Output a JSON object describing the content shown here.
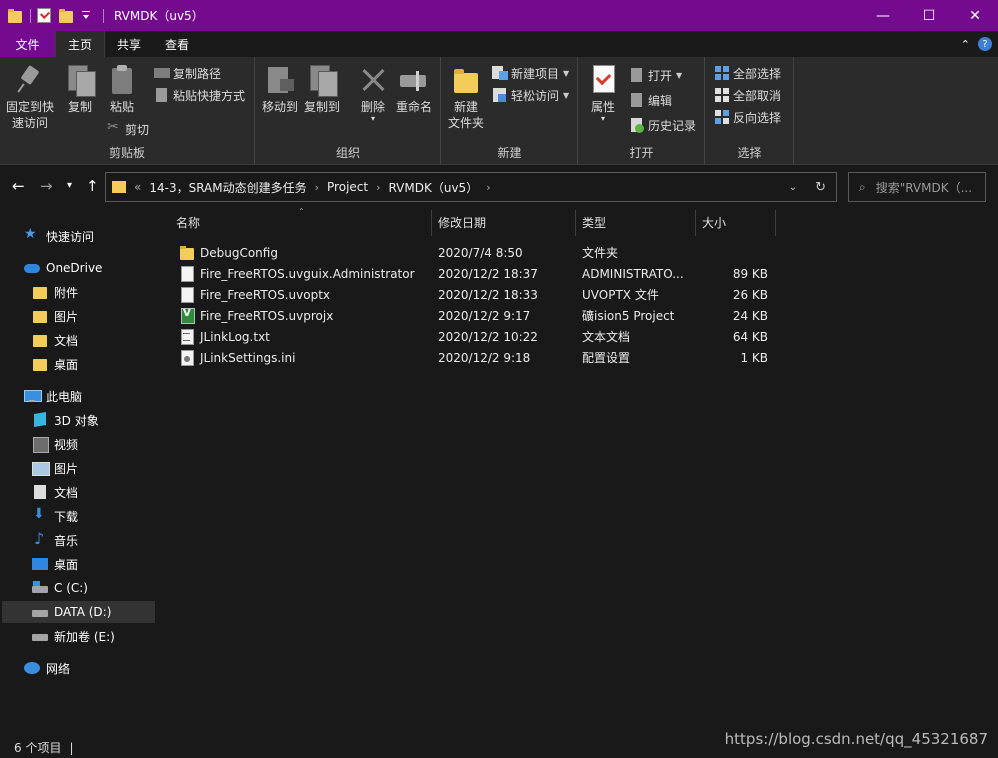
{
  "window": {
    "title": "RVMDK（uv5）",
    "controls": [
      "—",
      "☐",
      "✕"
    ],
    "accent": "#740b8f"
  },
  "ribbon_tabs": {
    "file": "文件",
    "home": "主页",
    "share": "共享",
    "view": "查看"
  },
  "ribbon": {
    "clipboard": {
      "label": "剪贴板",
      "pin": "固定到快\n速访问",
      "pin_l1": "固定到快",
      "pin_l2": "速访问",
      "copy": "复制",
      "paste": "粘贴",
      "copy_path": "复制路径",
      "paste_shortcut": "粘贴快捷方式",
      "cut": "剪切"
    },
    "organize": {
      "label": "组织",
      "move_to": "移动到",
      "copy_to": "复制到",
      "delete": "删除",
      "rename": "重命名"
    },
    "new": {
      "label": "新建",
      "new_folder_l1": "新建",
      "new_folder_l2": "文件夹",
      "new_item": "新建项目",
      "easy_access": "轻松访问"
    },
    "open": {
      "label": "打开",
      "properties": "属性",
      "open": "打开",
      "edit": "编辑",
      "history": "历史记录"
    },
    "select": {
      "label": "选择",
      "select_all": "全部选择",
      "select_none": "全部取消",
      "invert": "反向选择"
    }
  },
  "address": {
    "overflow": "«",
    "crumbs": [
      "14-3，SRAM动态创建多任务",
      "Project",
      "RVMDK（uv5）"
    ],
    "search_placeholder": "搜索\"RVMDK（..."
  },
  "nav": {
    "quick_access": "快速访问",
    "onedrive": "OneDrive",
    "onedrive_items": [
      "附件",
      "图片",
      "文档",
      "桌面"
    ],
    "this_pc": "此电脑",
    "pc_items": [
      "3D 对象",
      "视频",
      "图片",
      "文档",
      "下载",
      "音乐",
      "桌面",
      "C (C:)",
      "DATA (D:)",
      "新加卷 (E:)"
    ],
    "network": "网络"
  },
  "columns": {
    "name": "名称",
    "date": "修改日期",
    "type": "类型",
    "size": "大小"
  },
  "files": [
    {
      "name": "DebugConfig",
      "date": "2020/7/4 8:50",
      "type": "文件夹",
      "size": "",
      "icon": "folder-icon"
    },
    {
      "name": "Fire_FreeRTOS.uvguix.Administrator",
      "date": "2020/12/2 18:37",
      "type": "ADMINISTRATO...",
      "size": "89 KB",
      "icon": "file-icon"
    },
    {
      "name": "Fire_FreeRTOS.uvoptx",
      "date": "2020/12/2 18:33",
      "type": "UVOPTX 文件",
      "size": "26 KB",
      "icon": "file-icon"
    },
    {
      "name": "Fire_FreeRTOS.uvprojx",
      "date": "2020/12/2 9:17",
      "type": "礦ision5 Project",
      "size": "24 KB",
      "icon": "keil-project-icon"
    },
    {
      "name": "JLinkLog.txt",
      "date": "2020/12/2 10:22",
      "type": "文本文档",
      "size": "64 KB",
      "icon": "text-file-icon"
    },
    {
      "name": "JLinkSettings.ini",
      "date": "2020/12/2 9:18",
      "type": "配置设置",
      "size": "1 KB",
      "icon": "settings-file-icon"
    }
  ],
  "status": {
    "item_count": "6 个项目",
    "separator": "|"
  },
  "watermark": "https://blog.csdn.net/qq_45321687"
}
